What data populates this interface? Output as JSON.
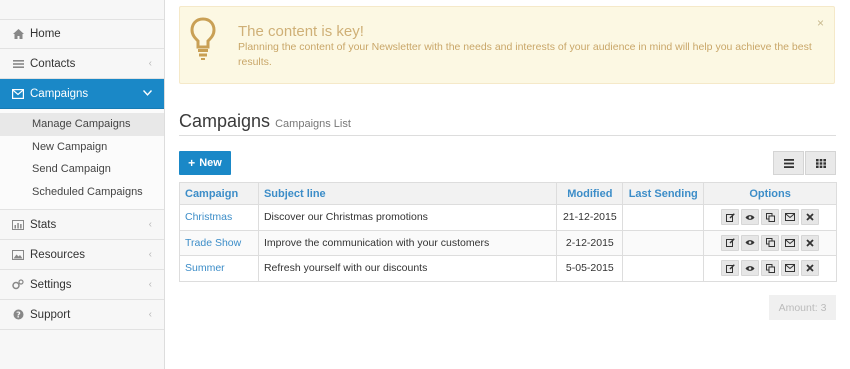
{
  "sidebar": {
    "home": "Home",
    "contacts": "Contacts",
    "campaigns": "Campaigns",
    "submenu": [
      "Manage Campaigns",
      "New Campaign",
      "Send Campaign",
      "Scheduled Campaigns"
    ],
    "stats": "Stats",
    "resources": "Resources",
    "settings": "Settings",
    "support": "Support"
  },
  "alert": {
    "title": "The content is key!",
    "text": "Planning the content of your Newsletter with the needs and interests of your audience in mind will help you achieve the best results.",
    "close": "×"
  },
  "page": {
    "title": "Campaigns",
    "subtitle": "Campaigns List"
  },
  "toolbar": {
    "new_label": "New"
  },
  "table": {
    "headers": [
      "Campaign",
      "Subject line",
      "Modified",
      "Last Sending",
      "Options"
    ],
    "rows": [
      {
        "campaign": "Christmas",
        "subject": "Discover our Christmas promotions",
        "modified": "21-12-2015",
        "last": ""
      },
      {
        "campaign": "Trade Show",
        "subject": "Improve the communication with your customers",
        "modified": "2-12-2015",
        "last": ""
      },
      {
        "campaign": "Summer",
        "subject": "Refresh yourself with our discounts",
        "modified": "5-05-2015",
        "last": ""
      }
    ]
  },
  "footer": {
    "amount": "Amount: 3"
  },
  "colors": {
    "primary": "#1a88c7",
    "link": "#3c8dc8",
    "alert_bg": "#fcf8e3",
    "alert_text": "#c09853"
  }
}
